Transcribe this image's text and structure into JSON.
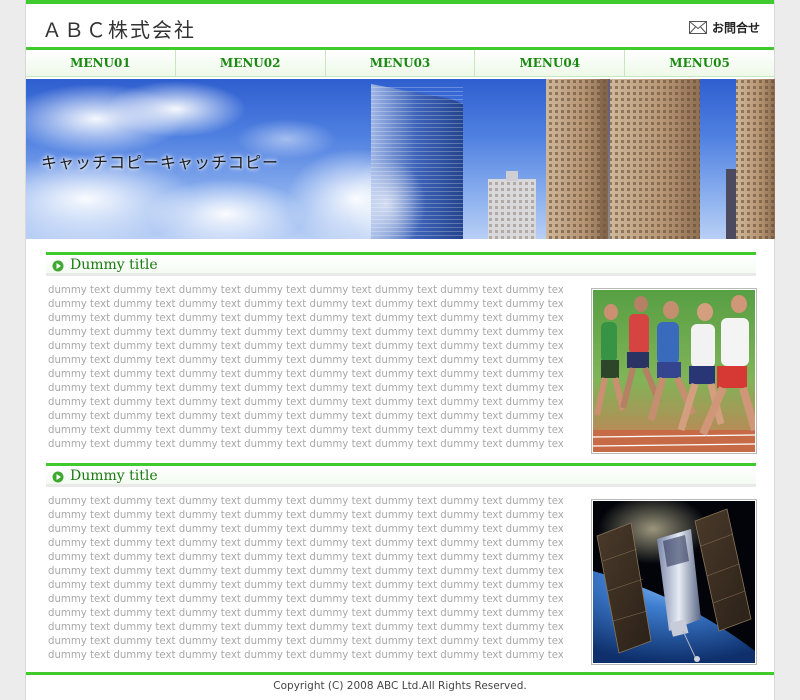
{
  "header": {
    "company_name": "ＡＢＣ株式会社",
    "contact_label": "お問合せ"
  },
  "nav": {
    "items": [
      "MENU01",
      "MENU02",
      "MENU03",
      "MENU04",
      "MENU05"
    ]
  },
  "hero": {
    "catch_copy": "キャッチコピーキャッチコピー"
  },
  "sections": [
    {
      "title": "Dummy title",
      "body_lines": [
        "dummy text dummy text dummy text dummy text dummy text dummy text dummy text dummy text",
        "dummy text dummy text dummy text dummy text dummy text dummy text dummy text dummy text",
        "dummy text dummy text dummy text dummy text dummy text dummy text dummy text dummy text",
        "dummy text dummy text dummy text dummy text dummy text dummy text dummy text dummy text",
        "dummy text dummy text dummy text dummy text dummy text dummy text dummy text dummy text",
        "dummy text dummy text dummy text dummy text dummy text dummy text dummy text dummy text",
        "dummy text dummy text dummy text dummy text dummy text dummy text dummy text dummy text",
        "dummy text dummy text dummy text dummy text dummy text dummy text dummy text dummy text",
        "dummy text dummy text dummy text dummy text dummy text dummy text dummy text dummy text",
        "dummy text dummy text dummy text dummy text dummy text dummy text dummy text dummy text",
        "dummy text dummy text dummy text dummy text dummy text dummy text dummy text dummy text",
        "dummy text dummy text dummy text dummy text dummy text dummy text dummy text dummy text"
      ],
      "image": "runners-photo"
    },
    {
      "title": "Dummy title",
      "body_lines": [
        "dummy text dummy text dummy text dummy text dummy text dummy text dummy text dummy text",
        "dummy text dummy text dummy text dummy text dummy text dummy text dummy text dummy text",
        "dummy text dummy text dummy text dummy text dummy text dummy text dummy text dummy text",
        "dummy text dummy text dummy text dummy text dummy text dummy text dummy text dummy text",
        "dummy text dummy text dummy text dummy text dummy text dummy text dummy text dummy text",
        "dummy text dummy text dummy text dummy text dummy text dummy text dummy text dummy text",
        "dummy text dummy text dummy text dummy text dummy text dummy text dummy text dummy text",
        "dummy text dummy text dummy text dummy text dummy text dummy text dummy text dummy text",
        "dummy text dummy text dummy text dummy text dummy text dummy text dummy text dummy text",
        "dummy text dummy text dummy text dummy text dummy text dummy text dummy text dummy text",
        "dummy text dummy text dummy text dummy text dummy text dummy text dummy text dummy text",
        "dummy text dummy text dummy text dummy text dummy text dummy text dummy text dummy text"
      ],
      "image": "satellite-photo"
    }
  ],
  "footer": {
    "copyright": "Copyright (C) 2008 ABC Ltd.All Rights Reserved."
  },
  "colors": {
    "accent_green": "#3fca2e",
    "nav_text": "#1c8a12",
    "body_text": "#a8a8a8"
  },
  "icons": {
    "contact": "mail-icon",
    "section_bullet": "play-circle-icon"
  }
}
